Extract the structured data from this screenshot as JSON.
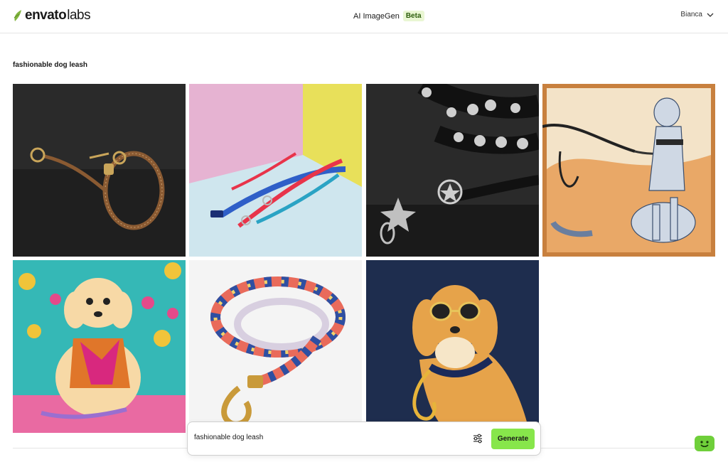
{
  "header": {
    "logo_main": "envato",
    "logo_sub": "labs",
    "app_title": "AI ImageGen",
    "beta_badge": "Beta",
    "user_name": "Bianca"
  },
  "prompt_heading": "fashionable dog leash",
  "images": [
    {
      "subject": "brown leather leash with gold clasps on dark background"
    },
    {
      "subject": "colorful pink and blue leashes against pastel walls"
    },
    {
      "subject": "black studded leash with silver star charm"
    },
    {
      "subject": "illustrated grey dog held on leash, vintage frame"
    },
    {
      "subject": "fluffy dog in floral harness on flowered fabric"
    },
    {
      "subject": "woven multicolor rope leash with gold hook"
    },
    {
      "subject": "golden dog with sunglasses on navy background"
    }
  ],
  "prompt_bar": {
    "value": "fashionable dog leash",
    "generate_label": "Generate"
  },
  "colors": {
    "accent": "#87e64b",
    "beta_bg": "#e9f6d3"
  },
  "icons": {
    "settings": "sliders-icon",
    "chevron": "chevron-down-icon",
    "helper": "smiley-chat-icon"
  }
}
